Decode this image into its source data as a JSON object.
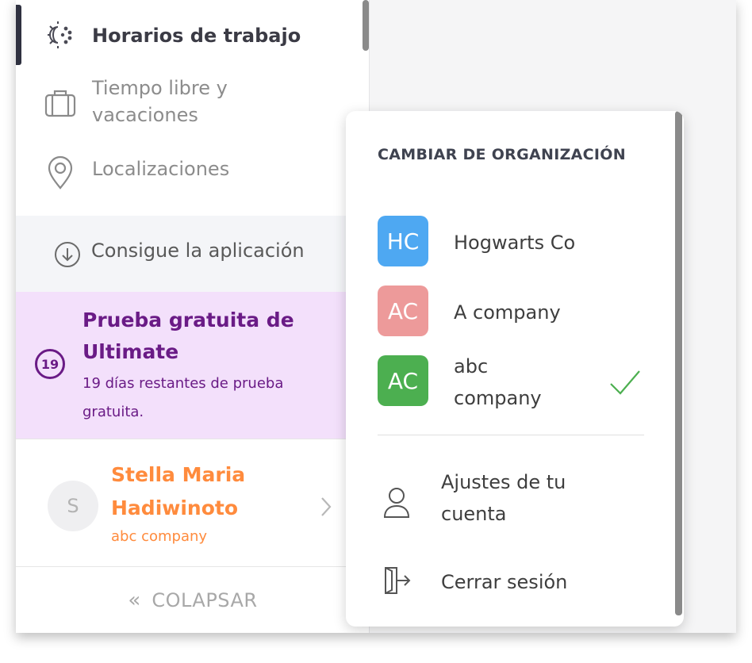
{
  "sidebar": {
    "nav": [
      {
        "label": "Horarios de trabajo",
        "icon": "sun-icon",
        "active": true
      },
      {
        "label": "Tiempo libre y\nvacaciones",
        "icon": "suitcase-icon",
        "active": false
      },
      {
        "label": "Localizaciones",
        "icon": "location-pin-icon",
        "active": false
      }
    ],
    "get_app": {
      "label": "Consigue la aplicación",
      "icon": "download-circle-icon"
    },
    "trial": {
      "title": "Prueba gratuita de Ultimate",
      "subtitle": "19 días restantes de prueba gratuita.",
      "days": "19"
    },
    "user": {
      "initial": "S",
      "name": "Stella Maria Hadiwinoto",
      "org": "abc company"
    },
    "collapse": {
      "label": "COLAPSAR",
      "arrow": "«"
    }
  },
  "dropdown": {
    "heading": "CAMBIAR DE ORGANIZACIÓN",
    "orgs": [
      {
        "initials": "HC",
        "name": "Hogwarts Co",
        "color": "#4ea8f2",
        "selected": false
      },
      {
        "initials": "AC",
        "name": "A company",
        "color": "#ed9a9a",
        "selected": false
      },
      {
        "initials": "AC",
        "name": "abc company",
        "color": "#4caf50",
        "selected": true
      }
    ],
    "actions": [
      {
        "label": "Ajustes de tu cuenta",
        "icon": "user-icon"
      },
      {
        "label": "Cerrar sesión",
        "icon": "logout-icon"
      }
    ]
  },
  "colors": {
    "trial_bg": "#f3e0fb",
    "trial_text": "#6a1b86",
    "user_accent": "#ff8b3d",
    "check": "#4caf50"
  }
}
